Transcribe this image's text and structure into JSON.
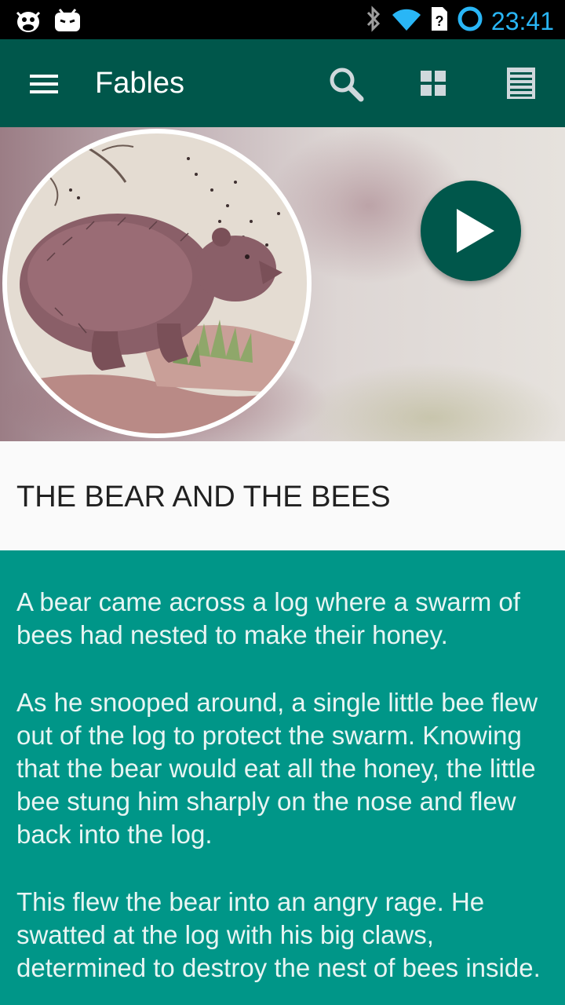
{
  "status_bar": {
    "time": "23:41",
    "left_icons": [
      "cyanogen-mascot-icon",
      "android-notification-icon"
    ],
    "right_icons": [
      "bluetooth-icon",
      "wifi-icon",
      "no-sim-icon",
      "sync-ring-icon"
    ],
    "time_color": "#29b6f6"
  },
  "toolbar": {
    "title": "Fables",
    "menu_icon": "hamburger-menu-icon",
    "actions": [
      "search-icon",
      "grid-view-icon",
      "list-view-icon"
    ],
    "color": "#00574b"
  },
  "hero": {
    "image": "bear-illustration",
    "play_icon": "play-icon"
  },
  "fable": {
    "title": "THE BEAR AND THE BEES",
    "paragraphs": [
      "A bear came across a log where a swarm of bees had nested to make their honey.",
      "As he snooped around, a single little bee flew out of the log to protect the swarm. Knowing that the bear would eat all the honey, the little bee stung him sharply on the nose and flew back into the log.",
      "This flew the bear into an angry rage. He swatted at the log with his big claws, determined to destroy the nest of bees inside."
    ]
  },
  "colors": {
    "primary_dark": "#00574b",
    "body_background": "#009688",
    "title_background": "#fafafa"
  }
}
